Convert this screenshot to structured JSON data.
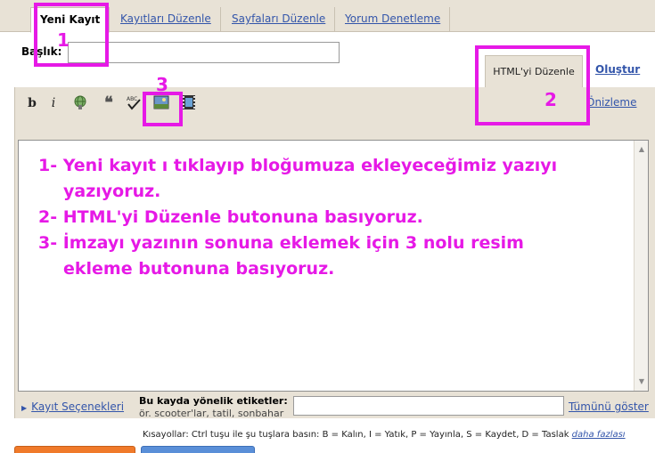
{
  "tabs": [
    {
      "label": "Yeni Kayıt",
      "active": true
    },
    {
      "label": "Kayıtları Düzenle"
    },
    {
      "label": "Sayfaları Düzenle"
    },
    {
      "label": "Yorum Denetleme"
    }
  ],
  "title_field": {
    "label": "Başlık:",
    "value": ""
  },
  "editor_modes": {
    "html_tab": "HTML'yi Düzenle",
    "compose_tab": "Oluştur",
    "preview": "Önizleme"
  },
  "toolbar": {
    "bold_label": "b",
    "italic_label": "i",
    "icons": [
      "bold-icon",
      "italic-icon",
      "link-icon",
      "quote-icon",
      "spellcheck-icon",
      "image-icon",
      "video-icon"
    ]
  },
  "post_lines": [
    "1- Yeni kayıt ı tıklayıp bloğumuza ekleyeceğimiz yazıyı",
    "yazıyoruz.",
    "2- HTML'yi Düzenle butonuna basıyoruz.",
    "3- İmzayı yazının sonuna eklemek için 3 nolu resim",
    "ekleme butonuna basıyoruz."
  ],
  "post_options": {
    "link": "Kayıt Seçenekleri",
    "labels_title": "Bu kayda yönelik etiketler:",
    "labels_hint": "ör. scooter'lar, tatil, sonbahar",
    "labels_value": "",
    "show_all": "Tümünü göster"
  },
  "shortcuts": {
    "text": "Kısayollar: Ctrl tuşu ile şu tuşlara basın: B = Kalın, I = Yatık, P = Yayınla, S = Kaydet, D = Taslak",
    "more": "daha fazlası"
  },
  "annotations": {
    "one": "1",
    "two": "2",
    "three": "3"
  },
  "colors": {
    "annotation": "#e619e6",
    "link": "#3355aa",
    "panel": "#e8e2d6",
    "publish_button": "#f07a2a",
    "save_button": "#5a8fd8"
  }
}
